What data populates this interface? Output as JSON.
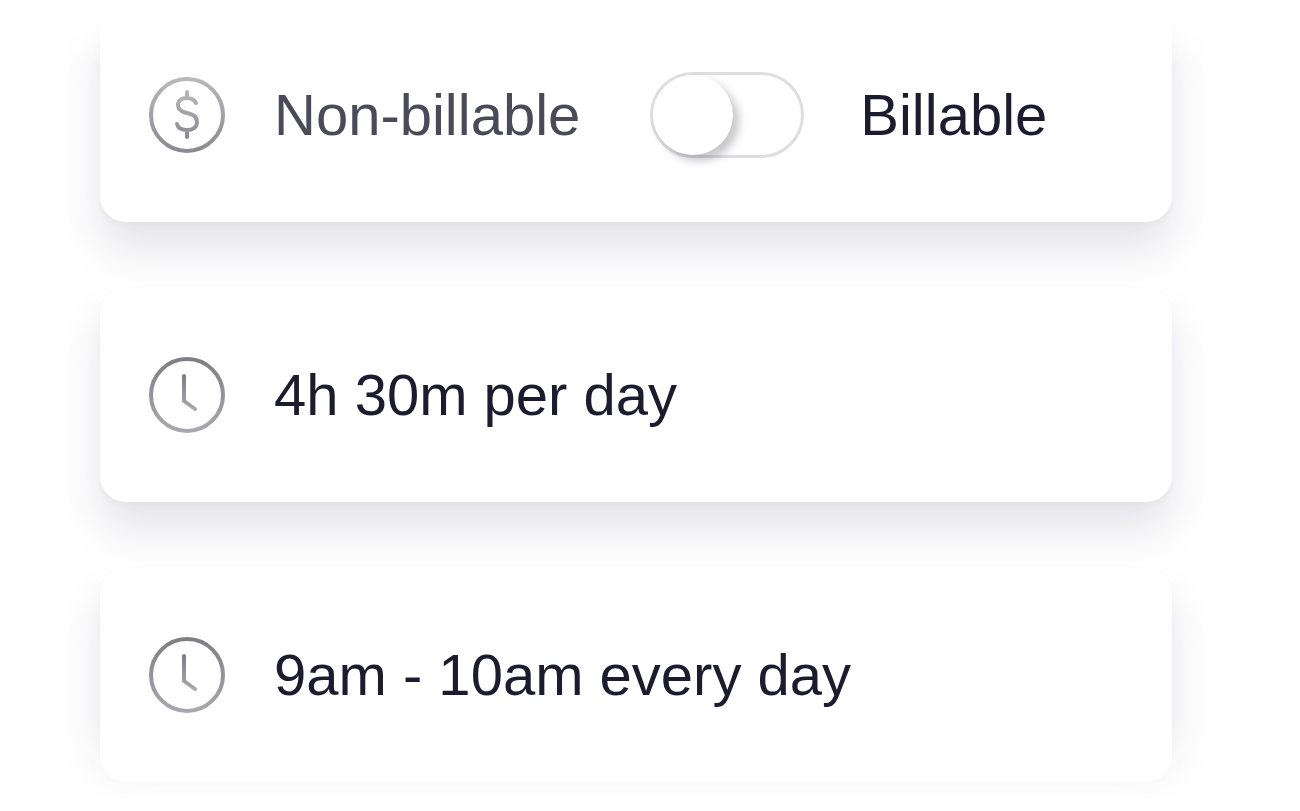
{
  "rows": [
    {
      "kind": "toggle",
      "off_label": "Non-billable",
      "on_label": "Billable",
      "on": false
    },
    {
      "kind": "text",
      "text": "4h 30m per day"
    },
    {
      "kind": "text",
      "text": "9am - 10am every day"
    }
  ]
}
